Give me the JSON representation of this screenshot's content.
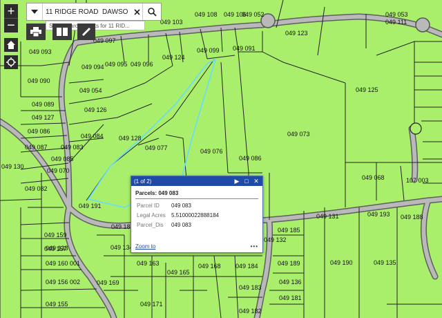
{
  "search": {
    "value": "11 RIDGE ROAD  DAWSON",
    "hint": "Show search results for 11 RID..."
  },
  "map_controls": {
    "zoom_in": "+",
    "zoom_out": "−"
  },
  "colors": {
    "parcel_fill": "#a9ef6b",
    "parcel_line": "#222222",
    "road": "#8c8c8c",
    "highlight": "#66ddff",
    "popup_header": "#1f4aa8"
  },
  "parcels": [
    "049 108",
    "049 106",
    "049 052",
    "049 053",
    "049 111",
    "049 103",
    "049 123",
    "049 093",
    "049 097",
    "049 099",
    "049 091",
    "049 094",
    "049 095",
    "049 096",
    "049 124",
    "049 090",
    "049 054",
    "049 125",
    "049 089",
    "049 126",
    "049 073",
    "049 127",
    "049 086",
    "049 084",
    "049 128",
    "049 087",
    "049 083",
    "049 077",
    "049 076",
    "049 086",
    "049 085",
    "049 070",
    "049 068",
    "107 003",
    "049 130",
    "049 082",
    "049 191",
    "049 193",
    "049 188",
    "049 131",
    "049 159",
    "049 185 001",
    "049 185",
    "049 132",
    "049 133",
    "049 157",
    "049 134",
    "049 160 001",
    "049 163",
    "049 165",
    "049 168",
    "049 184",
    "049 189",
    "049 190",
    "049 135",
    "049 156 002",
    "049 169",
    "049 183",
    "049 136",
    "049 155",
    "049 171",
    "049 182",
    "049 181"
  ],
  "popup": {
    "count": "(1 of 2)",
    "title": "Parcels: 049 083",
    "fields": [
      {
        "key": "Parcel ID",
        "value": "049 083"
      },
      {
        "key": "Legal Acres",
        "value": "5.51000022888184"
      },
      {
        "key": "Parcel_Dis",
        "value": "049 083"
      }
    ],
    "zoom_label": "Zoom to",
    "more_label": "•••",
    "next_label": "▶",
    "max_label": "□",
    "close_label": "✕"
  }
}
